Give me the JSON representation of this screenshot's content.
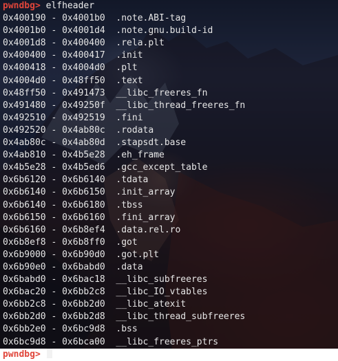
{
  "terminal": {
    "prompt": "pwndbg>",
    "command": "elfheader",
    "separator": "-",
    "sections": [
      {
        "start": "0x400190",
        "end": "0x4001b0",
        "name": ".note.ABI-tag"
      },
      {
        "start": "0x4001b0",
        "end": "0x4001d4",
        "name": ".note.gnu.build-id"
      },
      {
        "start": "0x4001d8",
        "end": "0x400400",
        "name": ".rela.plt"
      },
      {
        "start": "0x400400",
        "end": "0x400417",
        "name": ".init"
      },
      {
        "start": "0x400418",
        "end": "0x4004d0",
        "name": ".plt"
      },
      {
        "start": "0x4004d0",
        "end": "0x48ff50",
        "name": ".text"
      },
      {
        "start": "0x48ff50",
        "end": "0x491473",
        "name": "__libc_freeres_fn"
      },
      {
        "start": "0x491480",
        "end": "0x49250f",
        "name": "__libc_thread_freeres_fn"
      },
      {
        "start": "0x492510",
        "end": "0x492519",
        "name": ".fini"
      },
      {
        "start": "0x492520",
        "end": "0x4ab80c",
        "name": ".rodata"
      },
      {
        "start": "0x4ab80c",
        "end": "0x4ab80d",
        "name": ".stapsdt.base"
      },
      {
        "start": "0x4ab810",
        "end": "0x4b5e28",
        "name": ".eh_frame"
      },
      {
        "start": "0x4b5e28",
        "end": "0x4b5ed6",
        "name": ".gcc_except_table"
      },
      {
        "start": "0x6b6120",
        "end": "0x6b6140",
        "name": ".tdata"
      },
      {
        "start": "0x6b6140",
        "end": "0x6b6150",
        "name": ".init_array"
      },
      {
        "start": "0x6b6140",
        "end": "0x6b6180",
        "name": ".tbss"
      },
      {
        "start": "0x6b6150",
        "end": "0x6b6160",
        "name": ".fini_array"
      },
      {
        "start": "0x6b6160",
        "end": "0x6b8ef4",
        "name": ".data.rel.ro"
      },
      {
        "start": "0x6b8ef8",
        "end": "0x6b8ff0",
        "name": ".got"
      },
      {
        "start": "0x6b9000",
        "end": "0x6b90d0",
        "name": ".got.plt"
      },
      {
        "start": "0x6b90e0",
        "end": "0x6babd0",
        "name": ".data"
      },
      {
        "start": "0x6babd0",
        "end": "0x6bac18",
        "name": "__libc_subfreeres"
      },
      {
        "start": "0x6bac20",
        "end": "0x6bb2c8",
        "name": "__libc_IO_vtables"
      },
      {
        "start": "0x6bb2c8",
        "end": "0x6bb2d0",
        "name": "__libc_atexit"
      },
      {
        "start": "0x6bb2d0",
        "end": "0x6bb2d8",
        "name": "__libc_thread_subfreeres"
      },
      {
        "start": "0x6bb2e0",
        "end": "0x6bc9d8",
        "name": ".bss"
      },
      {
        "start": "0x6bc9d8",
        "end": "0x6bca00",
        "name": "__libc_freeres_ptrs"
      }
    ],
    "colors": {
      "prompt": "#e0453a",
      "text": "#e6e6e6"
    }
  }
}
